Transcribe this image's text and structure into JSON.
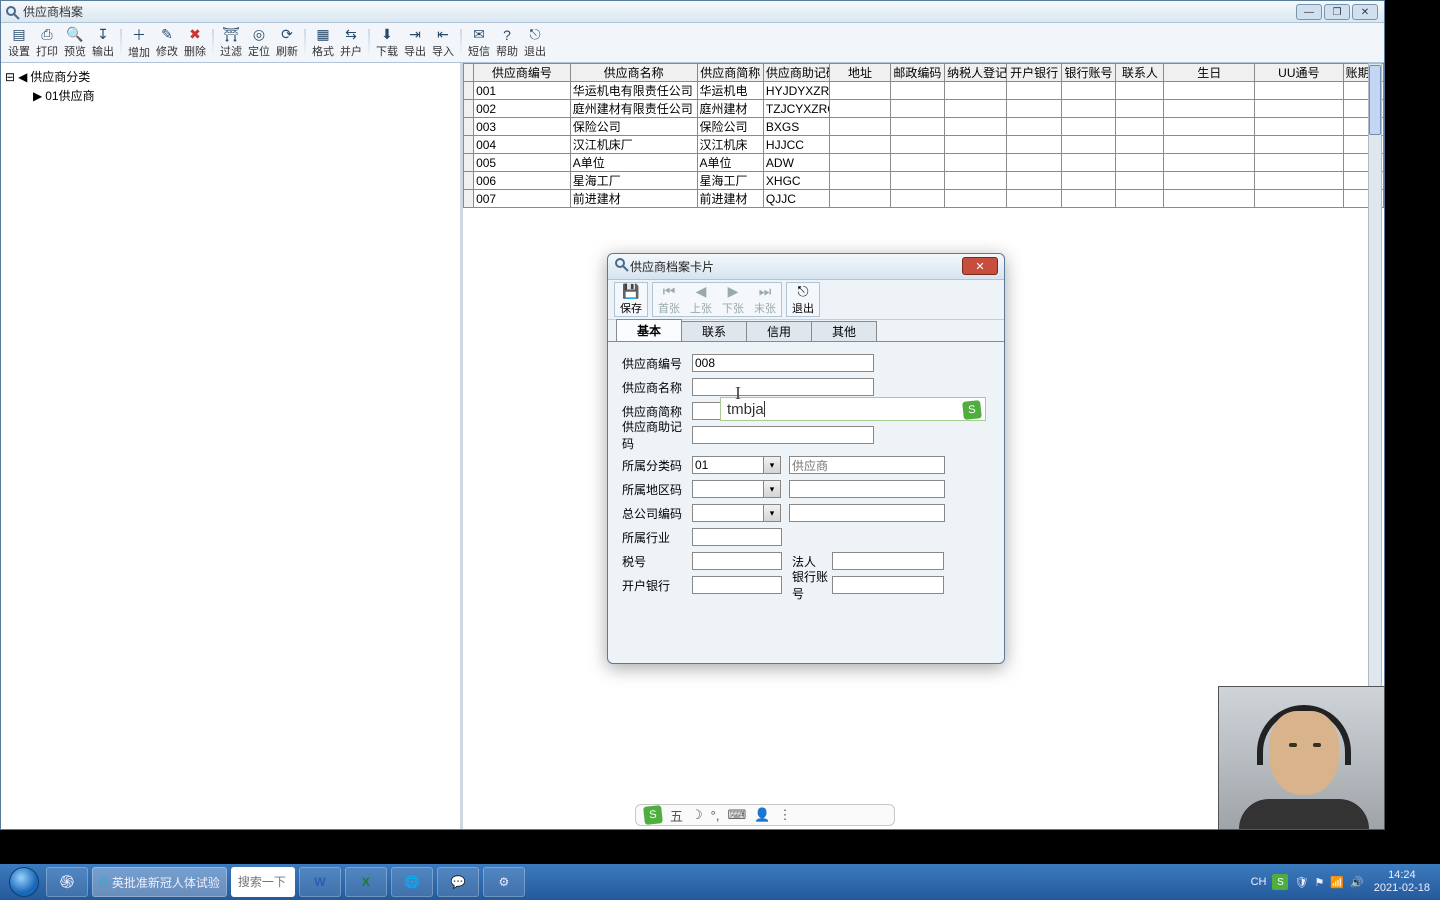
{
  "window": {
    "title": "供应商档案"
  },
  "toolbar": {
    "setup": "设置",
    "print": "打印",
    "preview": "预览",
    "output": "输出",
    "add": "增加",
    "edit": "修改",
    "delete": "删除",
    "filter": "过滤",
    "locate": "定位",
    "refresh": "刷新",
    "format": "格式",
    "merge": "并户",
    "download": "下载",
    "export": "导出",
    "import": "导入",
    "sms": "短信",
    "help": "帮助",
    "exit": "退出"
  },
  "tree": {
    "root": "供应商分类",
    "child": "01供应商"
  },
  "grid": {
    "headers": [
      "供应商编号",
      "供应商名称",
      "供应商简称",
      "供应商助记码",
      "地址",
      "邮政编码",
      "纳税人登记",
      "开户银行",
      "银行账号",
      "联系人",
      "生日",
      "UU通号",
      "账期管"
    ],
    "rows": [
      {
        "c0": "001",
        "c1": "华运机电有限责任公司",
        "c2": "华运机电",
        "c3": "HYJDYXZRG"
      },
      {
        "c0": "002",
        "c1": "庭州建材有限责任公司",
        "c2": "庭州建材",
        "c3": "TZJCYXZRG"
      },
      {
        "c0": "003",
        "c1": "保险公司",
        "c2": "保险公司",
        "c3": "BXGS"
      },
      {
        "c0": "004",
        "c1": "汉江机床厂",
        "c2": "汉江机床",
        "c3": "HJJCC"
      },
      {
        "c0": "005",
        "c1": "A单位",
        "c2": "A单位",
        "c3": "ADW"
      },
      {
        "c0": "006",
        "c1": "星海工厂",
        "c2": "星海工厂",
        "c3": "XHGC"
      },
      {
        "c0": "007",
        "c1": "前进建材",
        "c2": "前进建材",
        "c3": "QJJC"
      }
    ]
  },
  "dialog": {
    "title": "供应商档案卡片",
    "tb": {
      "save": "保存",
      "first": "首张",
      "prev": "上张",
      "next": "下张",
      "last": "末张",
      "exit": "退出"
    },
    "tabs": {
      "basic": "基本",
      "contact": "联系",
      "credit": "信用",
      "other": "其他"
    },
    "labels": {
      "code": "供应商编号",
      "name": "供应商名称",
      "short": "供应商简称",
      "mnemonic": "供应商助记码",
      "classcode": "所属分类码",
      "regioncode": "所属地区码",
      "hqcode": "总公司编码",
      "industry": "所属行业",
      "taxno": "税号",
      "legal": "法人",
      "bank": "开户银行",
      "account": "银行账号"
    },
    "values": {
      "code": "008",
      "classcode": "01",
      "classdesc": "供应商"
    }
  },
  "ime": {
    "candidate": "tmbja",
    "floatText": "五",
    "symbols": "ﾐ  ° ,  ⌨  ⚙  ⋮"
  },
  "taskbar": {
    "browserTask": "英批准新冠人体试验",
    "search_placeholder": "搜索一下",
    "lang": "CH",
    "time": "14:24",
    "date": "2021-02-18"
  }
}
